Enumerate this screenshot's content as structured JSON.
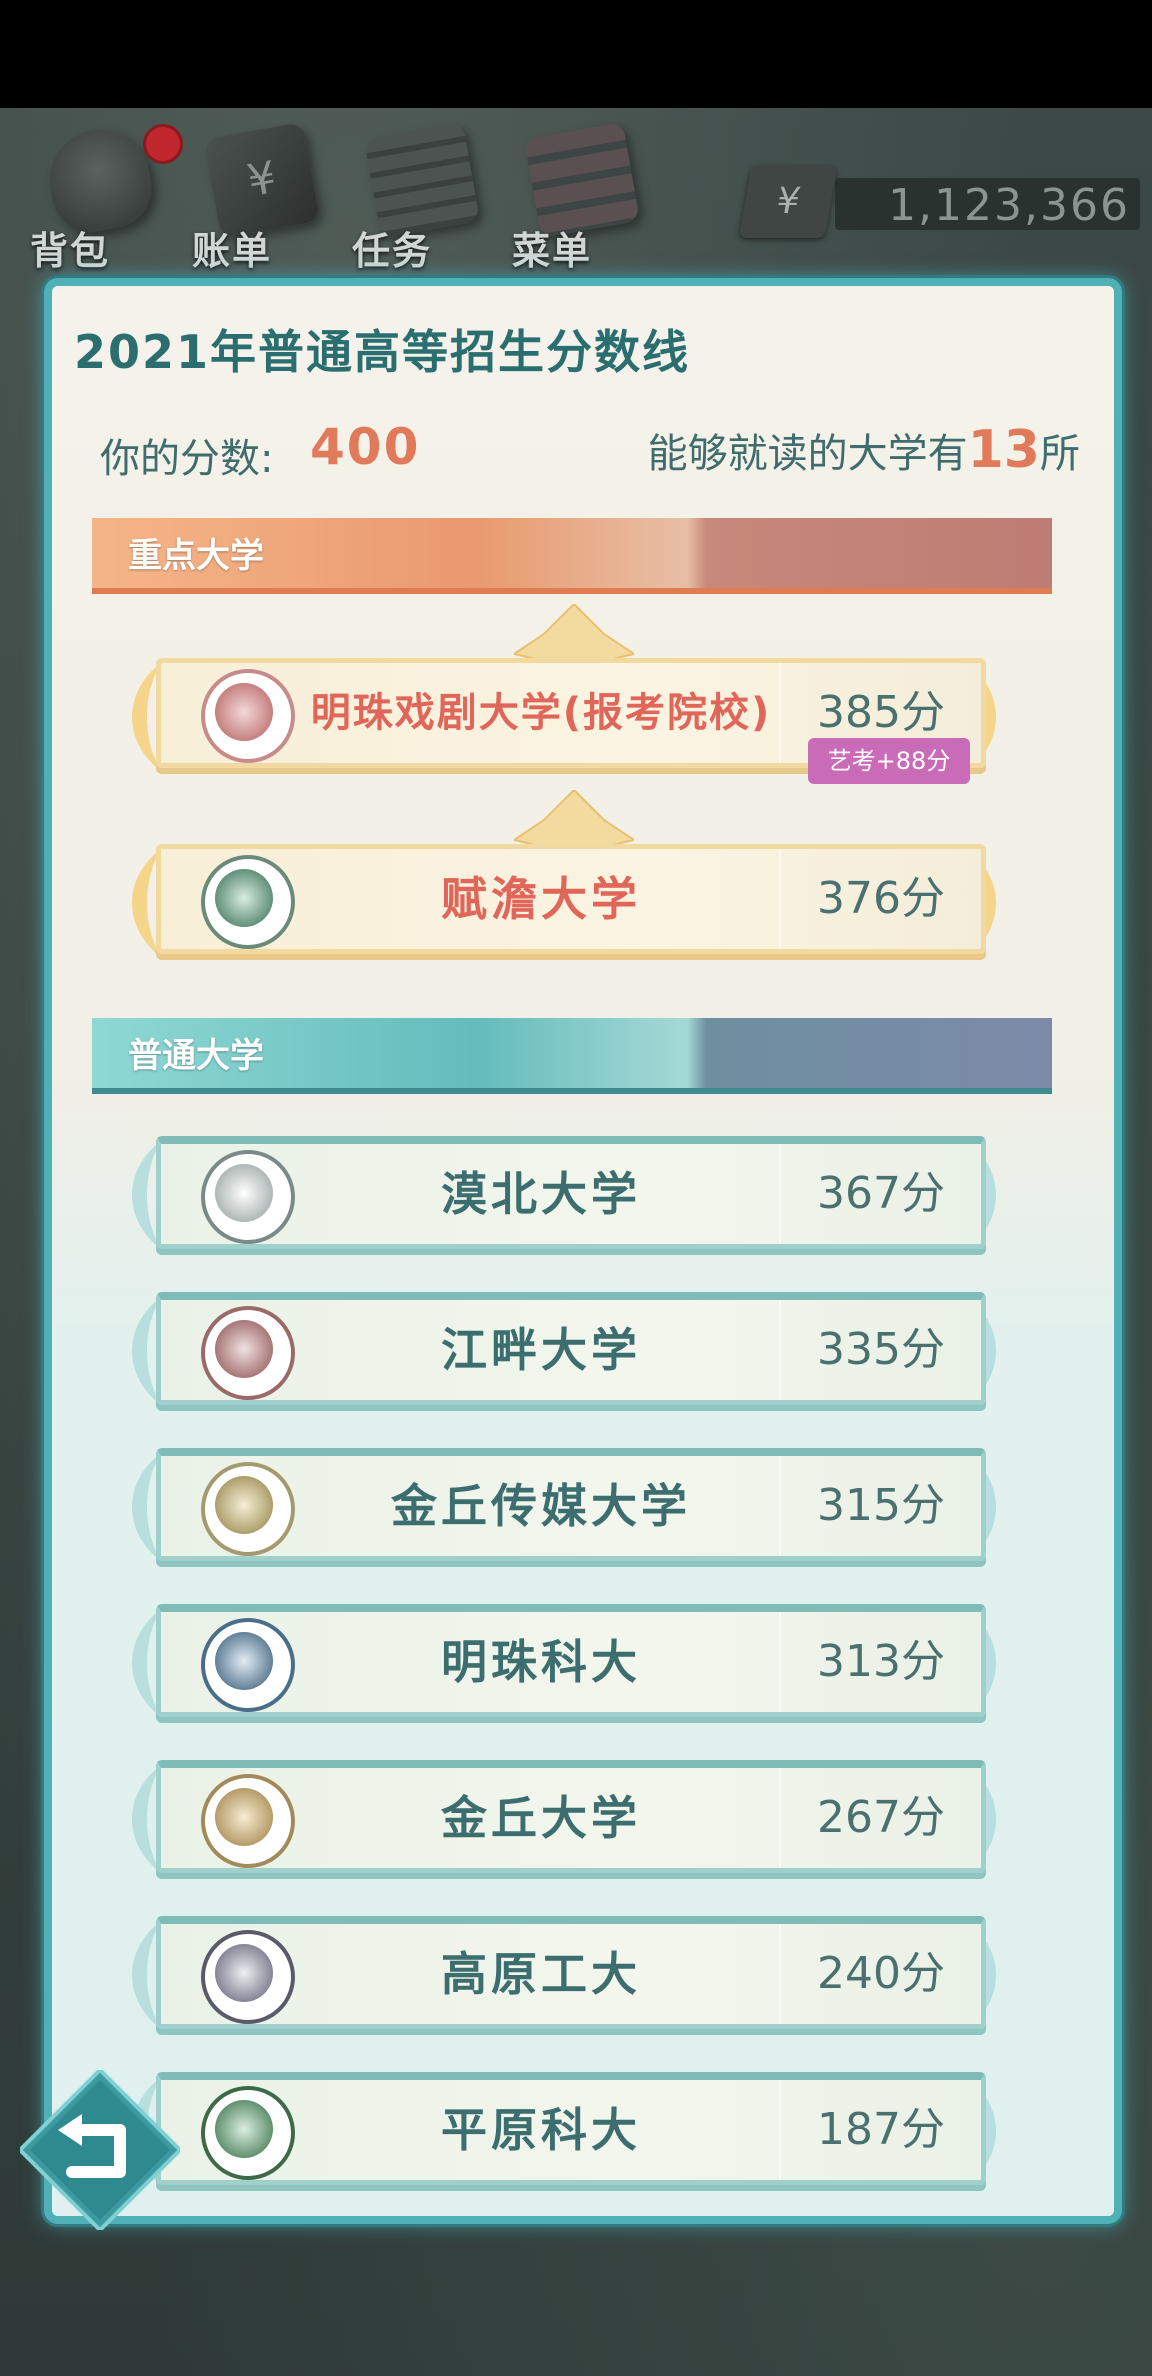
{
  "nav": {
    "items": [
      {
        "label": "背包",
        "icon": "backpack-icon",
        "has_badge": true
      },
      {
        "label": "账单",
        "icon": "bill-icon",
        "has_badge": false
      },
      {
        "label": "任务",
        "icon": "task-icon",
        "has_badge": false
      },
      {
        "label": "菜单",
        "icon": "menu-icon",
        "has_badge": false
      }
    ],
    "money_symbol": "¥",
    "money": "1,123,366"
  },
  "panel": {
    "title": "2021年普通高等招生分数线",
    "score_label": "你的分数:",
    "score_value": "400",
    "can_attend_prefix": "能够就读的大学有",
    "can_attend_count": "13",
    "can_attend_suffix": "所"
  },
  "key_section": {
    "label": "重点大学",
    "universities": [
      {
        "name": "明珠戏剧大学(报考院校)",
        "score": "385分",
        "tag": "艺考+88分",
        "name_color": "#e0665a"
      },
      {
        "name": "赋澹大学",
        "score": "376分",
        "name_color": "#e0665a"
      }
    ]
  },
  "normal_section": {
    "label": "普通大学",
    "universities": [
      {
        "name": "漠北大学",
        "score": "367分"
      },
      {
        "name": "江畔大学",
        "score": "335分"
      },
      {
        "name": "金丘传媒大学",
        "score": "315分"
      },
      {
        "name": "明珠科大",
        "score": "313分"
      },
      {
        "name": "金丘大学",
        "score": "267分"
      },
      {
        "name": "高原工大",
        "score": "240分"
      },
      {
        "name": "平原科大",
        "score": "187分"
      }
    ]
  },
  "colors": {
    "accent": "#4fb0b6",
    "highlight": "#e07a5a",
    "tag": "#c96bb6"
  }
}
